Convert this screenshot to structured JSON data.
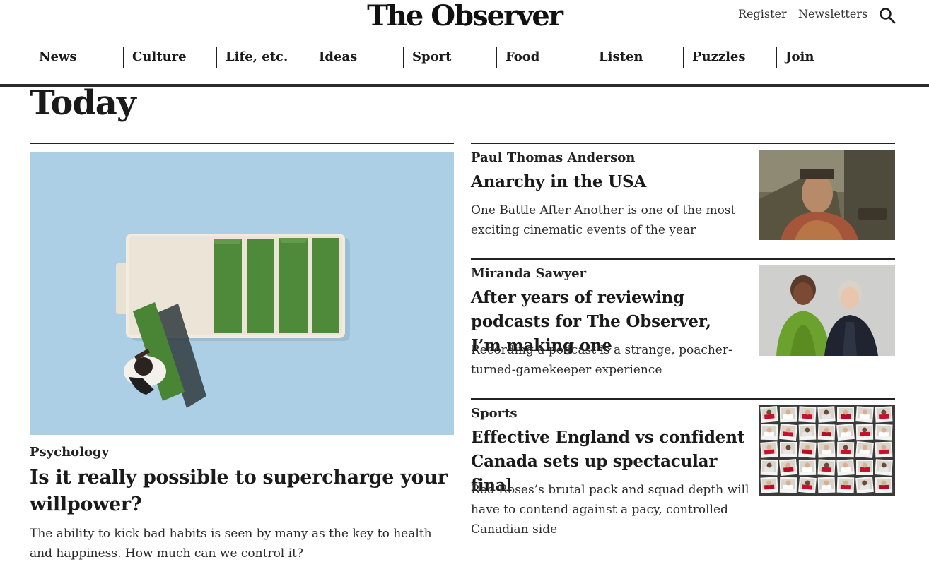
{
  "masthead": {
    "logo": "The Observer",
    "register_label": "Register",
    "newsletters_label": "Newsletters",
    "search_icon": "search-icon"
  },
  "nav": {
    "items": [
      {
        "label": "News"
      },
      {
        "label": "Culture"
      },
      {
        "label": "Life, etc."
      },
      {
        "label": "Ideas"
      },
      {
        "label": "Sport"
      },
      {
        "label": "Food"
      },
      {
        "label": "Listen"
      },
      {
        "label": "Puzzles"
      },
      {
        "label": "Join"
      }
    ]
  },
  "page": {
    "title": "Today"
  },
  "lead": {
    "kicker": "Psychology",
    "headline": "Is it really possible to supercharge your willpower?",
    "standfirst": "The ability to kick bad habits is seen by many as the key to health and happiness. How much can we control it?"
  },
  "stories": [
    {
      "kicker": "Paul Thomas Anderson",
      "headline": "Anarchy in the USA",
      "standfirst": "One Battle After Another is one of the most exciting cinematic events of the year"
    },
    {
      "kicker": "Miranda Sawyer",
      "headline": "After years of reviewing podcasts for The Observer, I’m making one",
      "standfirst": "Recording a podcast is a strange, poacher-turned-gamekeeper experience"
    },
    {
      "kicker": "Sports",
      "headline": "Effective England vs confident Canada sets up spectacular final",
      "standfirst": "Red Roses’s brutal pack and squad depth will have to contend against a pacy, controlled Canadian side"
    }
  ],
  "colors": {
    "text": "#1a1a1a",
    "rule": "#222222",
    "illustration_sky": "#a9cde3",
    "battery_green": "#4f8a3a"
  }
}
